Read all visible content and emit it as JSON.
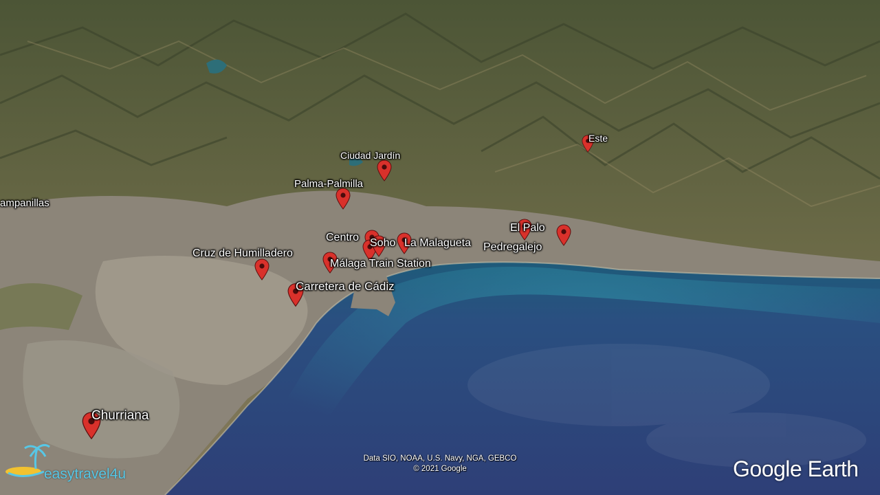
{
  "map": {
    "places": [
      {
        "id": "este",
        "label": "Este"
      },
      {
        "id": "ciudad-jardin",
        "label": "Ciudad Jardín"
      },
      {
        "id": "palma-palmilla",
        "label": "Palma-Palmilla"
      },
      {
        "id": "campanillas",
        "label": "ampanillas"
      },
      {
        "id": "centro",
        "label": "Centro"
      },
      {
        "id": "soho",
        "label": "Soho"
      },
      {
        "id": "la-malagueta",
        "label": "La Malagueta"
      },
      {
        "id": "el-palo",
        "label": "El Palo"
      },
      {
        "id": "pedregalejo",
        "label": "Pedregalejo"
      },
      {
        "id": "cruz-de-humilladero",
        "label": "Cruz de Humilladero"
      },
      {
        "id": "malaga-train-station",
        "label": "Málaga Train Station"
      },
      {
        "id": "carretera-de-cadiz",
        "label": "Carretera de Cádiz"
      },
      {
        "id": "churriana",
        "label": "Churriana"
      }
    ],
    "pin_color": "#d9312b"
  },
  "attribution": {
    "line1": "Data SIO, NOAA, U.S. Navy, NGA, GEBCO",
    "line2": "© 2021 Google"
  },
  "logo": {
    "text": "Google Earth"
  },
  "brand": {
    "text": "easytravel4u",
    "color": "#57c7e6"
  }
}
